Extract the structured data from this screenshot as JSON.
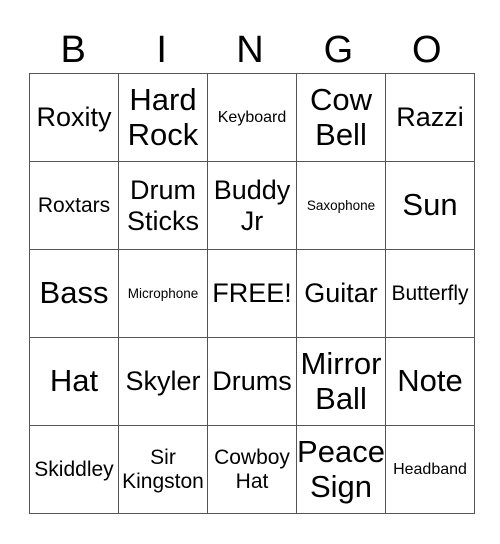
{
  "header": {
    "letters": [
      "B",
      "I",
      "N",
      "G",
      "O"
    ]
  },
  "grid": {
    "rows": [
      [
        {
          "text": "Roxity",
          "size": "l"
        },
        {
          "text": "Hard Rock",
          "size": "xl"
        },
        {
          "text": "Keyboard",
          "size": "s"
        },
        {
          "text": "Cow Bell",
          "size": "xl"
        },
        {
          "text": "Razzi",
          "size": "l"
        }
      ],
      [
        {
          "text": "Roxtars",
          "size": "m"
        },
        {
          "text": "Drum Sticks",
          "size": "l"
        },
        {
          "text": "Buddy Jr",
          "size": "l"
        },
        {
          "text": "Saxophone",
          "size": "xs"
        },
        {
          "text": "Sun",
          "size": "xl"
        }
      ],
      [
        {
          "text": "Bass",
          "size": "xl"
        },
        {
          "text": "Microphone",
          "size": "xs"
        },
        {
          "text": "FREE!",
          "size": "l"
        },
        {
          "text": "Guitar",
          "size": "l"
        },
        {
          "text": "Butterfly",
          "size": "m"
        }
      ],
      [
        {
          "text": "Hat",
          "size": "xl"
        },
        {
          "text": "Skyler",
          "size": "l"
        },
        {
          "text": "Drums",
          "size": "l"
        },
        {
          "text": "Mirror Ball",
          "size": "xl"
        },
        {
          "text": "Note",
          "size": "xl"
        }
      ],
      [
        {
          "text": "Skiddley",
          "size": "m"
        },
        {
          "text": "Sir Kingston",
          "size": "m"
        },
        {
          "text": "Cowboy Hat",
          "size": "m"
        },
        {
          "text": "Peace Sign",
          "size": "xl"
        },
        {
          "text": "Headband",
          "size": "s"
        }
      ]
    ]
  }
}
